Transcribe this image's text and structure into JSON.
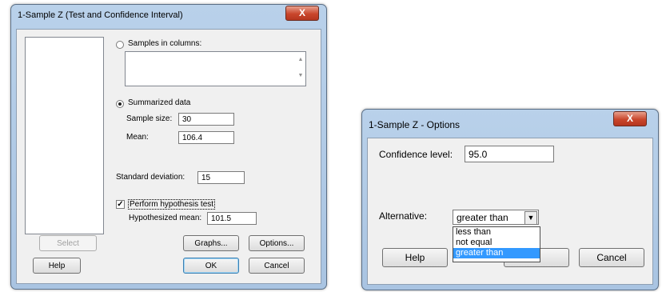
{
  "dialog1": {
    "title": "1-Sample Z (Test and Confidence Interval)",
    "close_glyph": "X",
    "samples_in_columns_label": "Samples in columns:",
    "samples_in_columns_selected": false,
    "summarized_label": "Summarized data",
    "summarized_selected": true,
    "sample_size_label": "Sample size:",
    "sample_size_value": "30",
    "mean_label": "Mean:",
    "mean_value": "106.4",
    "std_label": "Standard deviation:",
    "std_value": "15",
    "perform_test_label": "Perform hypothesis test",
    "perform_test_checked": true,
    "perform_test_glyph": "✓",
    "hyp_mean_label": "Hypothesized mean:",
    "hyp_mean_value": "101.5",
    "scroll_up_glyph": "▲",
    "scroll_down_glyph": "▼",
    "select_button": "Select",
    "help_button": "Help",
    "graphs_button": "Graphs...",
    "options_button": "Options...",
    "ok_button": "OK",
    "cancel_button": "Cancel"
  },
  "dialog2": {
    "title": "1-Sample Z - Options",
    "close_glyph": "X",
    "confidence_label": "Confidence level:",
    "confidence_value": "95.0",
    "alternative_label": "Alternative:",
    "alternative_value": "greater than",
    "dropdown_glyph": "▼",
    "alternative_options": [
      "less than",
      "not equal",
      "greater than"
    ],
    "selected_option_index": 2,
    "help_button": "Help",
    "cancel_button": "Cancel"
  },
  "colors": {
    "frame": "#b9d1ea",
    "client": "#f0f0f0",
    "close_button": "#c9462c",
    "selection": "#3399ff"
  }
}
